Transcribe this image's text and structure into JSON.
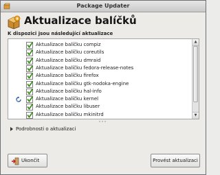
{
  "window": {
    "title": "Package Updater"
  },
  "header": {
    "title": "Aktualizace balíčků"
  },
  "section": {
    "title": "K dispozici jsou následující aktualizace"
  },
  "updates": [
    {
      "label": "Aktualizace balíčku compiz",
      "checked": true,
      "icon": ""
    },
    {
      "label": "Aktualizace balíčku coreutils",
      "checked": true,
      "icon": ""
    },
    {
      "label": "Aktualizace balíčku dmraid",
      "checked": true,
      "icon": ""
    },
    {
      "label": "Aktualizace balíčku fedora-release-notes",
      "checked": true,
      "icon": ""
    },
    {
      "label": "Aktualizace balíčku firefox",
      "checked": true,
      "icon": ""
    },
    {
      "label": "Aktualizace balíčku gtk-nodoka-engine",
      "checked": true,
      "icon": ""
    },
    {
      "label": "Aktualizace balíčku hal-info",
      "checked": true,
      "icon": ""
    },
    {
      "label": "Aktualizace balíčku kernel",
      "checked": true,
      "icon": "restart-icon"
    },
    {
      "label": "Aktualizace balíčku libuser",
      "checked": true,
      "icon": ""
    },
    {
      "label": "Aktualizace balíčku mkinitrd",
      "checked": true,
      "icon": ""
    }
  ],
  "details": {
    "label": "Podrobnosti o aktualizaci"
  },
  "buttons": {
    "quit_label": "Ukončit",
    "apply_label": "Provést aktualizaci"
  },
  "colors": {
    "check": "#3d8c1e",
    "header_icon": "#f0a218"
  }
}
